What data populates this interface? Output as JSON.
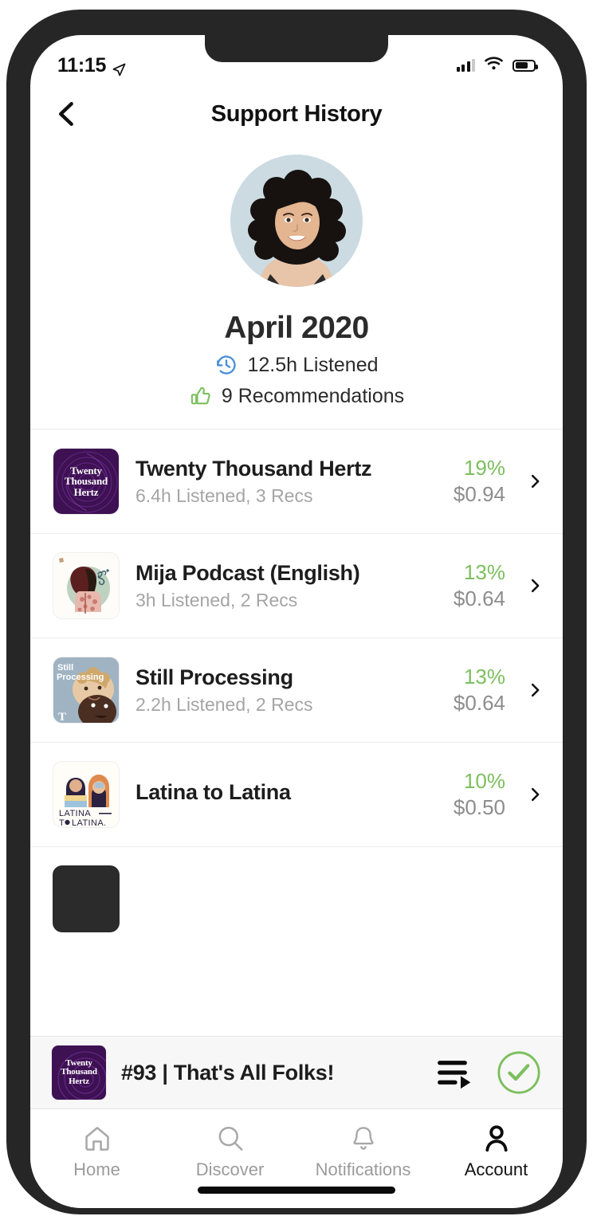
{
  "status_bar": {
    "time": "11:15",
    "location_icon": "location-arrow-icon",
    "signal_icon": "cellular-signal-icon",
    "wifi_icon": "wifi-icon",
    "battery_icon": "battery-icon",
    "battery_level_pct": 72
  },
  "header": {
    "back_icon": "chevron-left-icon",
    "title": "Support History"
  },
  "summary": {
    "avatar_name": "user-avatar",
    "month": "April 2020",
    "listened_icon": "history-clock-icon",
    "listened_text": "12.5h Listened",
    "recs_icon": "thumbs-up-icon",
    "recs_text": "9 Recommendations"
  },
  "colors": {
    "accent_green": "#7cbf5e",
    "muted_gray": "#8d8d8d",
    "sub_gray": "#a5a5a5",
    "clock_blue": "#4a90d9",
    "text_dark": "#1d1d1d"
  },
  "podcasts": [
    {
      "title": "Twenty Thousand Hertz",
      "subtitle": "6.4h Listened, 3 Recs",
      "percent": "19%",
      "amount": "$0.94",
      "artwork": "twenty-thousand-hertz-artwork"
    },
    {
      "title": "Mija Podcast (English)",
      "subtitle": "3h Listened, 2 Recs",
      "percent": "13%",
      "amount": "$0.64",
      "artwork": "mija-podcast-artwork"
    },
    {
      "title": "Still Processing",
      "subtitle": "2.2h Listened, 2 Recs",
      "percent": "13%",
      "amount": "$0.64",
      "artwork": "still-processing-artwork"
    },
    {
      "title": "Latina to Latina",
      "subtitle": "",
      "percent": "10%",
      "amount": "$0.50",
      "artwork": "latina-to-latina-artwork"
    }
  ],
  "chevron_icon": "chevron-right-icon",
  "player": {
    "artwork": "twenty-thousand-hertz-artwork",
    "title": "#93 | That's All Folks!",
    "queue_icon": "queue-playlist-icon",
    "complete_icon": "check-circle-icon"
  },
  "tabs": [
    {
      "label": "Home",
      "icon": "home-icon",
      "active": false
    },
    {
      "label": "Discover",
      "icon": "search-icon",
      "active": false
    },
    {
      "label": "Notifications",
      "icon": "bell-icon",
      "active": false
    },
    {
      "label": "Account",
      "icon": "person-icon",
      "active": true
    }
  ]
}
